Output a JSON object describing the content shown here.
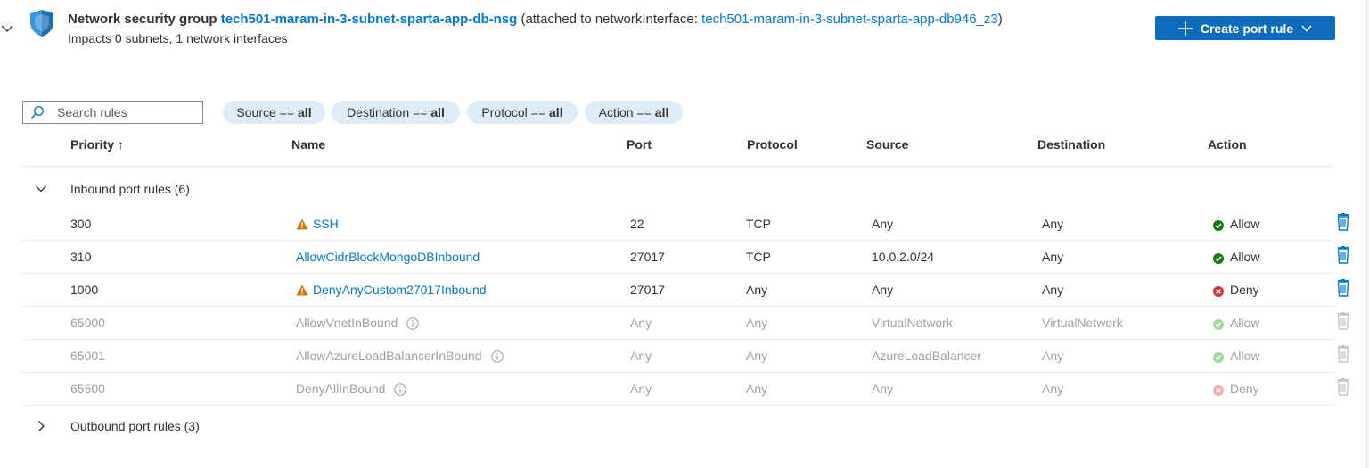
{
  "header": {
    "prefix": "Network security group",
    "nsg_name": "tech501-maram-in-3-subnet-sparta-app-db-nsg",
    "attached_text": "(attached to networkInterface:",
    "nic_name": "tech501-maram-in-3-subnet-sparta-app-db946_z3",
    "close_paren": ")",
    "impacts": "Impacts 0 subnets, 1 network interfaces"
  },
  "actions": {
    "create_label": "Create port rule"
  },
  "search": {
    "placeholder": "Search rules"
  },
  "filters": [
    {
      "label": "Source ==",
      "value": "all"
    },
    {
      "label": "Destination ==",
      "value": "all"
    },
    {
      "label": "Protocol ==",
      "value": "all"
    },
    {
      "label": "Action ==",
      "value": "all"
    }
  ],
  "columns": {
    "priority": "Priority ↑",
    "name": "Name",
    "port": "Port",
    "protocol": "Protocol",
    "source": "Source",
    "destination": "Destination",
    "action": "Action"
  },
  "inbound": {
    "label": "Inbound port rules (6)",
    "rules": [
      {
        "priority": "300",
        "name": "SSH",
        "port": "22",
        "protocol": "TCP",
        "source": "Any",
        "destination": "Any",
        "action": "Allow"
      },
      {
        "priority": "310",
        "name": "AllowCidrBlockMongoDBInbound",
        "port": "27017",
        "protocol": "TCP",
        "source": "10.0.2.0/24",
        "destination": "Any",
        "action": "Allow"
      },
      {
        "priority": "1000",
        "name": "DenyAnyCustom27017Inbound",
        "port": "27017",
        "protocol": "Any",
        "source": "Any",
        "destination": "Any",
        "action": "Deny"
      },
      {
        "priority": "65000",
        "name": "AllowVnetInBound",
        "port": "Any",
        "protocol": "Any",
        "source": "VirtualNetwork",
        "destination": "VirtualNetwork",
        "action": "Allow"
      },
      {
        "priority": "65001",
        "name": "AllowAzureLoadBalancerInBound",
        "port": "Any",
        "protocol": "Any",
        "source": "AzureLoadBalancer",
        "destination": "Any",
        "action": "Allow"
      },
      {
        "priority": "65500",
        "name": "DenyAllInBound",
        "port": "Any",
        "protocol": "Any",
        "source": "Any",
        "destination": "Any",
        "action": "Deny"
      }
    ]
  },
  "outbound": {
    "label": "Outbound port rules (3)"
  },
  "colors": {
    "accent": "#0078d4",
    "button": "#0f6cbd",
    "allow": "#107c10",
    "deny": "#d13438",
    "warning": "#d47500"
  }
}
